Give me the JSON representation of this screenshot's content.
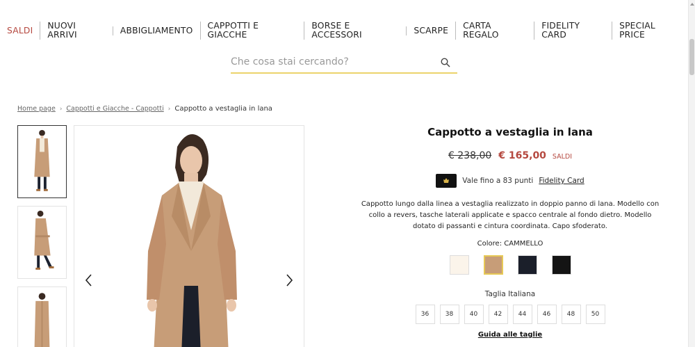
{
  "nav": {
    "items": [
      {
        "label": "SALDI",
        "sale": true
      },
      {
        "label": "NUOVI ARRIVI"
      },
      {
        "label": "ABBIGLIAMENTO"
      },
      {
        "label": "CAPPOTTI E GIACCHE"
      },
      {
        "label": "BORSE E ACCESSORI"
      },
      {
        "label": "SCARPE"
      },
      {
        "label": "CARTA REGALO"
      },
      {
        "label": "FIDELITY CARD"
      },
      {
        "label": "SPECIAL PRICE"
      }
    ]
  },
  "search": {
    "placeholder": "Che cosa stai cercando?",
    "value": "",
    "accent_color": "#ebd36b"
  },
  "breadcrumb": {
    "items": [
      "Home page",
      "Cappotti e Giacche - Cappotti"
    ],
    "current": "Cappotto a vestaglia in lana"
  },
  "product": {
    "title": "Cappotto a vestaglia in lana",
    "old_price": "€ 238,00",
    "new_price": "€ 165,00",
    "sale_tag": "SALDI",
    "fidelity_text": "Vale fino a 83 punti",
    "fidelity_link": "Fidelity Card",
    "description": "Cappotto lungo dalla linea a vestaglia realizzato in doppio panno di lana. Modello con collo a revers, tasche laterali applicate e spacco centrale al fondo dietro. Modello dotato di passanti e cintura coordinata. Capo sfoderato.",
    "color_label": "Colore: CAMMELLO",
    "swatches": [
      {
        "color": "#fbf4ea",
        "selected": false
      },
      {
        "color": "#c79d78",
        "selected": true
      },
      {
        "color": "#1b1f2a",
        "selected": false
      },
      {
        "color": "#141414",
        "selected": false
      }
    ],
    "size_title": "Taglia Italiana",
    "sizes": [
      "36",
      "38",
      "40",
      "42",
      "44",
      "46",
      "48",
      "50"
    ],
    "size_guide": "Guida alle taglie",
    "brand_color": "#b5483f"
  }
}
